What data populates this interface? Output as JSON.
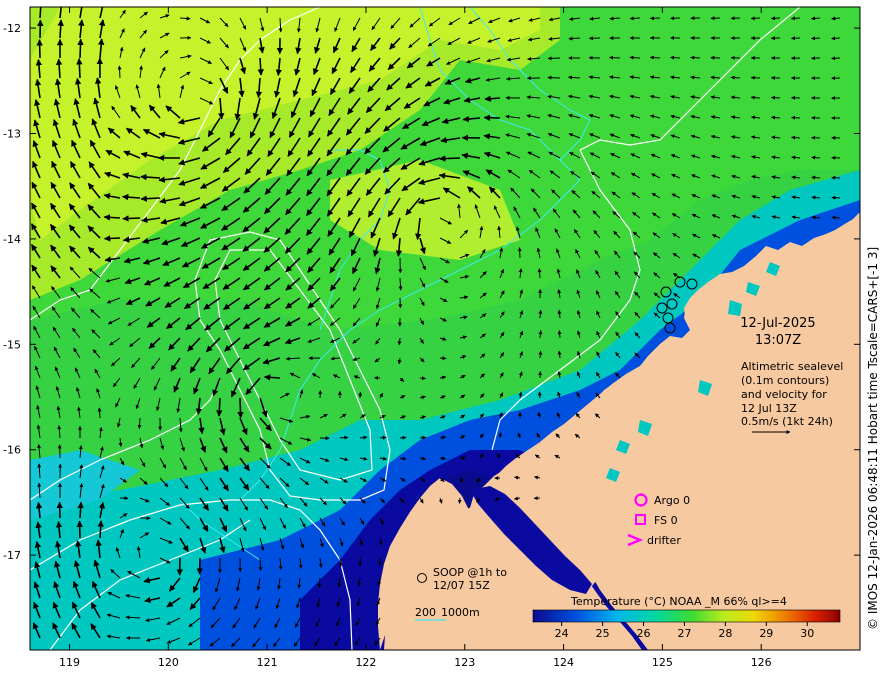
{
  "map": {
    "lon_ticks": [
      "119",
      "120",
      "121",
      "122",
      "123",
      "124",
      "125",
      "126"
    ],
    "lat_ticks": [
      "-12",
      "-13",
      "-14",
      "-15",
      "-16",
      "-17"
    ],
    "lon_range": [
      118.6,
      127.0
    ],
    "lat_range": [
      -11.8,
      -17.9
    ]
  },
  "annotations": {
    "date": "12-Jul-2025",
    "time": "13:07Z",
    "sealevel_lines": [
      "Altimetric sealevel",
      "(0.1m contours)",
      "and velocity for",
      "12 Jul 13Z",
      "0.5m/s (1kt 24h)"
    ],
    "soop_lines": [
      "SOOP @1h to",
      "12/07 15Z"
    ],
    "depth_200": "200",
    "depth_1000": "1000m"
  },
  "legend": {
    "argo": "Argo 0",
    "fs": "FS 0",
    "drifter": "drifter"
  },
  "colorbar": {
    "title": "Temperature (°C) NOAA _M 66% ql>=4",
    "ticks": [
      "24",
      "25",
      "26",
      "27",
      "28",
      "29",
      "30"
    ]
  },
  "side_label": "© IMOS 12-Jan-2026 06:48:11 Hobart time Tscale=CARS+[-1 3]",
  "colors": {
    "land": "#f7c9a0",
    "warm": "#b9ef2c",
    "mid": "#3fd83a",
    "cool": "#00c8c0",
    "cold": "#0048d8",
    "deep": "#0a0aa0",
    "marker": "#ff00ff"
  }
}
